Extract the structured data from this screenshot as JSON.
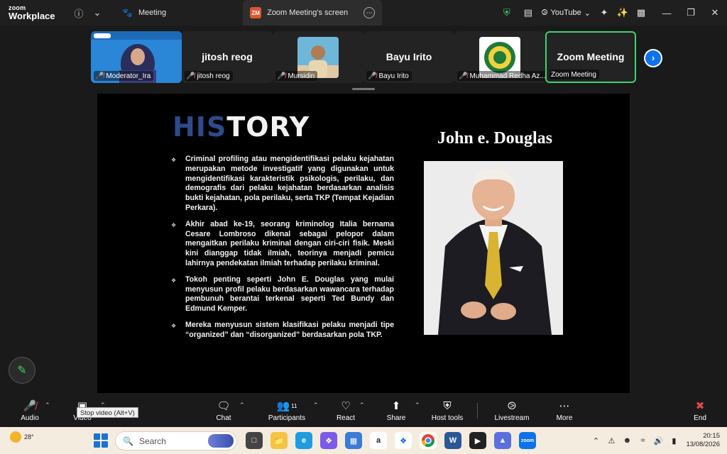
{
  "app": {
    "brand_line1": "zoom",
    "brand_line2": "Workplace"
  },
  "tabs": [
    {
      "label": "Meeting"
    },
    {
      "label": "Zoom Meeting's screen",
      "badge": "ZM"
    }
  ],
  "topbar_right": {
    "youtube_label": "YouTube"
  },
  "participants": [
    {
      "name": "Moderator_Ira"
    },
    {
      "name": "jitosh reog",
      "display": "jitosh reog"
    },
    {
      "name": "Mursidin"
    },
    {
      "name": "Bayu Irito",
      "display": "Bayu Irito"
    },
    {
      "name": "Muhammad Redha Az..."
    },
    {
      "name": "Zoom Meeting",
      "display": "Zoom Meeting"
    }
  ],
  "slide": {
    "title_part1": "HIS",
    "title_part2": "TORY",
    "person_name": "John e. Douglas",
    "bullets": [
      "Criminal profiling atau mengidentifikasi pelaku kejahatan merupakan metode investigatif yang digunakan untuk mengidentifikasi karakteristik psikologis, perilaku, dan demografis dari pelaku kejahatan berdasarkan analisis bukti kejahatan, pola perilaku, serta TKP (Tempat Kejadian Perkara).",
      "Akhir abad ke-19, seorang kriminolog Italia bernama Cesare Lombroso dikenal sebagai pelopor dalam mengaitkan perilaku kriminal dengan ciri-ciri fisik. Meski kini dianggap tidak ilmiah, teorinya menjadi pemicu lahirnya pendekatan ilmiah terhadap perilaku kriminal.",
      "Tokoh penting seperti John E. Douglas yang mulai menyusun profil pelaku berdasarkan wawancara terhadap pembunuh berantai terkenal seperti Ted Bundy dan Edmund Kemper.",
      "Mereka menyusun sistem klasifikasi pelaku menjadi tipe “organized” dan “disorganized” berdasarkan pola TKP."
    ]
  },
  "controls": {
    "audio": "Audio",
    "video": "Video",
    "chat": "Chat",
    "participants": "Participants",
    "participants_count": "11",
    "react": "React",
    "share": "Share",
    "host_tools": "Host tools",
    "livestream": "Livestream",
    "more": "More",
    "end": "End",
    "tooltip": "Stop video (Alt+V)"
  },
  "taskbar": {
    "weather_temp": "28°",
    "search_placeholder": "Search",
    "time": "20:15",
    "date": "13/08/2026"
  },
  "colors": {
    "accent_blue": "#0e72ed",
    "active_speaker_green": "#3ed36c",
    "mute_red": "#e5484d",
    "title_blue": "#2d4a8a"
  }
}
